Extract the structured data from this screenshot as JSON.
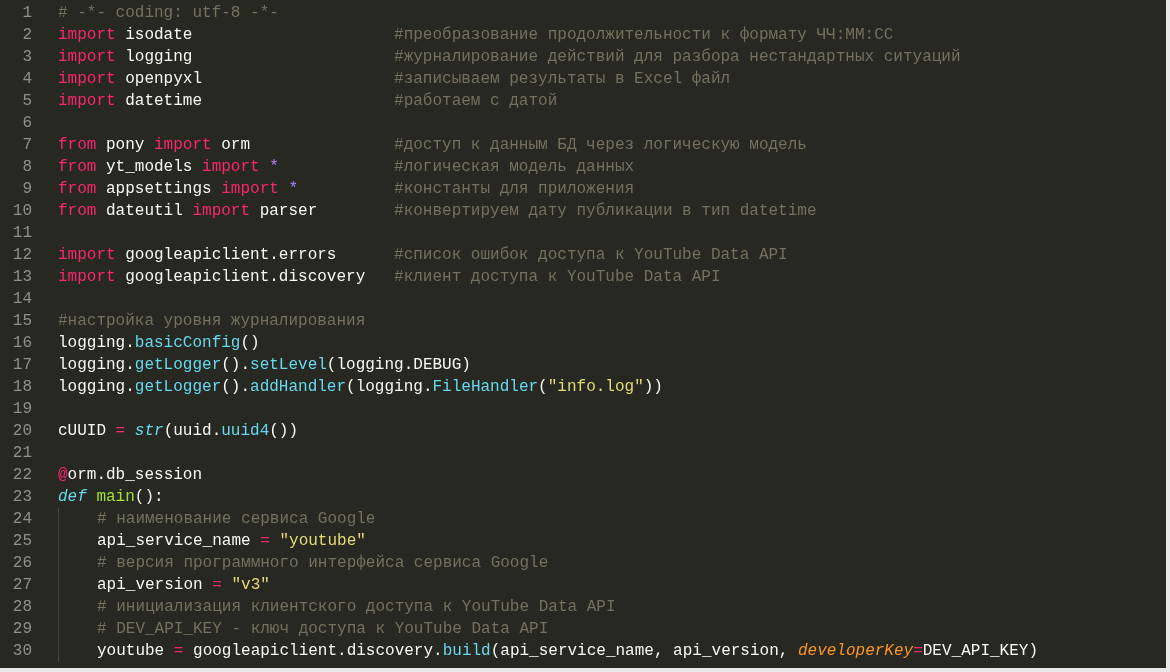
{
  "editor": {
    "lines": [
      {
        "number": "1",
        "tokens": [
          {
            "kind": "comment",
            "text": "# -*- coding: utf-8 -*-"
          }
        ]
      },
      {
        "number": "2",
        "tokens": [
          {
            "kind": "keyword",
            "text": "import"
          },
          {
            "kind": "plain",
            "text": " isodate"
          }
        ],
        "comment": "#преобразование продолжительности к формату ЧЧ:ММ:СС"
      },
      {
        "number": "3",
        "tokens": [
          {
            "kind": "keyword",
            "text": "import"
          },
          {
            "kind": "plain",
            "text": " logging"
          }
        ],
        "comment": "#журналирование действий для разбора нестандартных ситуаций"
      },
      {
        "number": "4",
        "tokens": [
          {
            "kind": "keyword",
            "text": "import"
          },
          {
            "kind": "plain",
            "text": " openpyxl"
          }
        ],
        "comment": "#записываем результаты в Excel файл"
      },
      {
        "number": "5",
        "tokens": [
          {
            "kind": "keyword",
            "text": "import"
          },
          {
            "kind": "plain",
            "text": " datetime"
          }
        ],
        "comment": "#работаем с датой"
      },
      {
        "number": "6"
      },
      {
        "number": "7",
        "tokens": [
          {
            "kind": "keyword",
            "text": "from"
          },
          {
            "kind": "plain",
            "text": " pony "
          },
          {
            "kind": "keyword",
            "text": "import"
          },
          {
            "kind": "plain",
            "text": " orm"
          }
        ],
        "comment": "#доступ к данным БД через логическую модель"
      },
      {
        "number": "8",
        "tokens": [
          {
            "kind": "keyword",
            "text": "from"
          },
          {
            "kind": "plain",
            "text": " yt_models "
          },
          {
            "kind": "keyword",
            "text": "import"
          },
          {
            "kind": "constant",
            "text": " *"
          }
        ],
        "comment": "#логическая модель данных"
      },
      {
        "number": "9",
        "tokens": [
          {
            "kind": "keyword",
            "text": "from"
          },
          {
            "kind": "plain",
            "text": " appsettings "
          },
          {
            "kind": "keyword",
            "text": "import"
          },
          {
            "kind": "constant",
            "text": " *"
          }
        ],
        "comment": "#константы для приложения"
      },
      {
        "number": "10",
        "tokens": [
          {
            "kind": "keyword",
            "text": "from"
          },
          {
            "kind": "plain",
            "text": " dateutil "
          },
          {
            "kind": "keyword",
            "text": "import"
          },
          {
            "kind": "plain",
            "text": " parser"
          }
        ],
        "comment": "#конвертируем дату публикации в тип datetime"
      },
      {
        "number": "11"
      },
      {
        "number": "12",
        "tokens": [
          {
            "kind": "keyword",
            "text": "import"
          },
          {
            "kind": "plain",
            "text": " googleapiclient.errors"
          }
        ],
        "comment": "#список ошибок доступа к YouTube Data API"
      },
      {
        "number": "13",
        "tokens": [
          {
            "kind": "keyword",
            "text": "import"
          },
          {
            "kind": "plain",
            "text": " googleapiclient.discovery"
          }
        ],
        "comment": "#клиент доступа к YouTube Data API"
      },
      {
        "number": "14"
      },
      {
        "number": "15",
        "tokens": [
          {
            "kind": "comment",
            "text": "#настройка уровня журналирования"
          }
        ]
      },
      {
        "number": "16",
        "tokens": [
          {
            "kind": "plain",
            "text": "logging."
          },
          {
            "kind": "function",
            "text": "basicConfig"
          },
          {
            "kind": "plain",
            "text": "()"
          }
        ]
      },
      {
        "number": "17",
        "tokens": [
          {
            "kind": "plain",
            "text": "logging."
          },
          {
            "kind": "function",
            "text": "getLogger"
          },
          {
            "kind": "plain",
            "text": "()."
          },
          {
            "kind": "function",
            "text": "setLevel"
          },
          {
            "kind": "plain",
            "text": "(logging.DEBUG)"
          }
        ]
      },
      {
        "number": "18",
        "tokens": [
          {
            "kind": "plain",
            "text": "logging."
          },
          {
            "kind": "function",
            "text": "getLogger"
          },
          {
            "kind": "plain",
            "text": "()."
          },
          {
            "kind": "function",
            "text": "addHandler"
          },
          {
            "kind": "plain",
            "text": "(logging."
          },
          {
            "kind": "function",
            "text": "FileHandler"
          },
          {
            "kind": "plain",
            "text": "("
          },
          {
            "kind": "string",
            "text": "\"info.log\""
          },
          {
            "kind": "plain",
            "text": "))"
          }
        ]
      },
      {
        "number": "19"
      },
      {
        "number": "20",
        "tokens": [
          {
            "kind": "plain",
            "text": "cUUID "
          },
          {
            "kind": "keyword",
            "text": "="
          },
          {
            "kind": "builtin",
            "text": " str"
          },
          {
            "kind": "plain",
            "text": "(uuid."
          },
          {
            "kind": "function",
            "text": "uuid4"
          },
          {
            "kind": "plain",
            "text": "())"
          }
        ]
      },
      {
        "number": "21"
      },
      {
        "number": "22",
        "tokens": [
          {
            "kind": "keyword",
            "text": "@"
          },
          {
            "kind": "plain",
            "text": "orm.db_session"
          }
        ]
      },
      {
        "number": "23",
        "tokens": [
          {
            "kind": "builtin",
            "text": "def"
          },
          {
            "kind": "name",
            "text": " main"
          },
          {
            "kind": "plain",
            "text": "():"
          }
        ]
      },
      {
        "number": "24",
        "indent_guide": true,
        "tokens": [
          {
            "kind": "comment",
            "text": "# наименование сервиса Google"
          }
        ]
      },
      {
        "number": "25",
        "indent_guide": true,
        "tokens": [
          {
            "kind": "plain",
            "text": "api_service_name "
          },
          {
            "kind": "keyword",
            "text": "="
          },
          {
            "kind": "string",
            "text": " \"youtube\""
          }
        ]
      },
      {
        "number": "26",
        "indent_guide": true,
        "tokens": [
          {
            "kind": "comment",
            "text": "# версия программного интерфейса сервиса Google"
          }
        ]
      },
      {
        "number": "27",
        "indent_guide": true,
        "tokens": [
          {
            "kind": "plain",
            "text": "api_version "
          },
          {
            "kind": "keyword",
            "text": "="
          },
          {
            "kind": "string",
            "text": " \"v3\""
          }
        ]
      },
      {
        "number": "28",
        "indent_guide": true,
        "tokens": [
          {
            "kind": "comment",
            "text": "# инициализация клиентского доступа к YouTube Data API"
          }
        ]
      },
      {
        "number": "29",
        "indent_guide": true,
        "tokens": [
          {
            "kind": "comment",
            "text": "# DEV_API_KEY - ключ доступа к YouTube Data API"
          }
        ]
      },
      {
        "number": "30",
        "indent_guide": true,
        "tokens": [
          {
            "kind": "plain",
            "text": "youtube "
          },
          {
            "kind": "keyword",
            "text": "="
          },
          {
            "kind": "plain",
            "text": " googleapiclient.discovery."
          },
          {
            "kind": "function",
            "text": "build"
          },
          {
            "kind": "plain",
            "text": "(api_service_name, api_version, "
          },
          {
            "kind": "param",
            "text": "developerKey"
          },
          {
            "kind": "keyword",
            "text": "="
          },
          {
            "kind": "plain",
            "text": "DEV_API_KEY)"
          }
        ]
      }
    ]
  }
}
